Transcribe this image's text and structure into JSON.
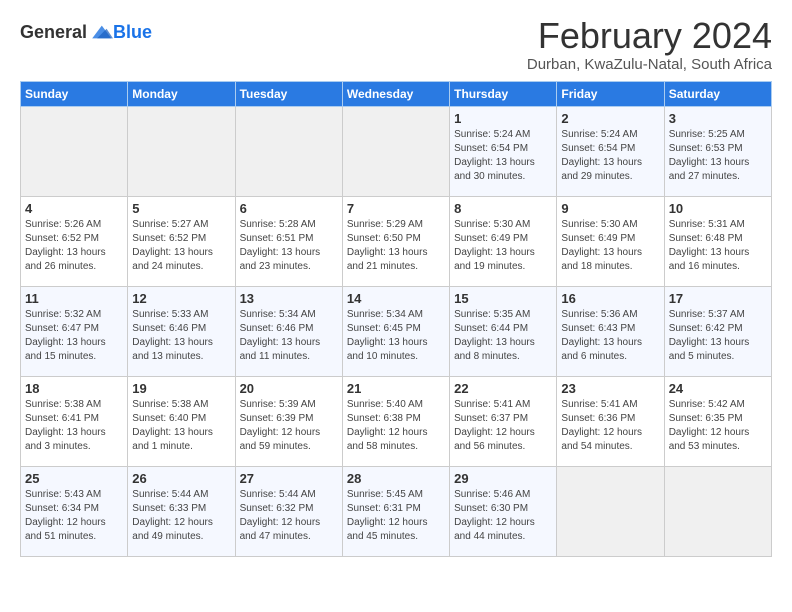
{
  "logo": {
    "general": "General",
    "blue": "Blue"
  },
  "title": "February 2024",
  "location": "Durban, KwaZulu-Natal, South Africa",
  "days_of_week": [
    "Sunday",
    "Monday",
    "Tuesday",
    "Wednesday",
    "Thursday",
    "Friday",
    "Saturday"
  ],
  "weeks": [
    [
      {
        "day": "",
        "info": ""
      },
      {
        "day": "",
        "info": ""
      },
      {
        "day": "",
        "info": ""
      },
      {
        "day": "",
        "info": ""
      },
      {
        "day": "1",
        "info": "Sunrise: 5:24 AM\nSunset: 6:54 PM\nDaylight: 13 hours\nand 30 minutes."
      },
      {
        "day": "2",
        "info": "Sunrise: 5:24 AM\nSunset: 6:54 PM\nDaylight: 13 hours\nand 29 minutes."
      },
      {
        "day": "3",
        "info": "Sunrise: 5:25 AM\nSunset: 6:53 PM\nDaylight: 13 hours\nand 27 minutes."
      }
    ],
    [
      {
        "day": "4",
        "info": "Sunrise: 5:26 AM\nSunset: 6:52 PM\nDaylight: 13 hours\nand 26 minutes."
      },
      {
        "day": "5",
        "info": "Sunrise: 5:27 AM\nSunset: 6:52 PM\nDaylight: 13 hours\nand 24 minutes."
      },
      {
        "day": "6",
        "info": "Sunrise: 5:28 AM\nSunset: 6:51 PM\nDaylight: 13 hours\nand 23 minutes."
      },
      {
        "day": "7",
        "info": "Sunrise: 5:29 AM\nSunset: 6:50 PM\nDaylight: 13 hours\nand 21 minutes."
      },
      {
        "day": "8",
        "info": "Sunrise: 5:30 AM\nSunset: 6:49 PM\nDaylight: 13 hours\nand 19 minutes."
      },
      {
        "day": "9",
        "info": "Sunrise: 5:30 AM\nSunset: 6:49 PM\nDaylight: 13 hours\nand 18 minutes."
      },
      {
        "day": "10",
        "info": "Sunrise: 5:31 AM\nSunset: 6:48 PM\nDaylight: 13 hours\nand 16 minutes."
      }
    ],
    [
      {
        "day": "11",
        "info": "Sunrise: 5:32 AM\nSunset: 6:47 PM\nDaylight: 13 hours\nand 15 minutes."
      },
      {
        "day": "12",
        "info": "Sunrise: 5:33 AM\nSunset: 6:46 PM\nDaylight: 13 hours\nand 13 minutes."
      },
      {
        "day": "13",
        "info": "Sunrise: 5:34 AM\nSunset: 6:46 PM\nDaylight: 13 hours\nand 11 minutes."
      },
      {
        "day": "14",
        "info": "Sunrise: 5:34 AM\nSunset: 6:45 PM\nDaylight: 13 hours\nand 10 minutes."
      },
      {
        "day": "15",
        "info": "Sunrise: 5:35 AM\nSunset: 6:44 PM\nDaylight: 13 hours\nand 8 minutes."
      },
      {
        "day": "16",
        "info": "Sunrise: 5:36 AM\nSunset: 6:43 PM\nDaylight: 13 hours\nand 6 minutes."
      },
      {
        "day": "17",
        "info": "Sunrise: 5:37 AM\nSunset: 6:42 PM\nDaylight: 13 hours\nand 5 minutes."
      }
    ],
    [
      {
        "day": "18",
        "info": "Sunrise: 5:38 AM\nSunset: 6:41 PM\nDaylight: 13 hours\nand 3 minutes."
      },
      {
        "day": "19",
        "info": "Sunrise: 5:38 AM\nSunset: 6:40 PM\nDaylight: 13 hours\nand 1 minute."
      },
      {
        "day": "20",
        "info": "Sunrise: 5:39 AM\nSunset: 6:39 PM\nDaylight: 12 hours\nand 59 minutes."
      },
      {
        "day": "21",
        "info": "Sunrise: 5:40 AM\nSunset: 6:38 PM\nDaylight: 12 hours\nand 58 minutes."
      },
      {
        "day": "22",
        "info": "Sunrise: 5:41 AM\nSunset: 6:37 PM\nDaylight: 12 hours\nand 56 minutes."
      },
      {
        "day": "23",
        "info": "Sunrise: 5:41 AM\nSunset: 6:36 PM\nDaylight: 12 hours\nand 54 minutes."
      },
      {
        "day": "24",
        "info": "Sunrise: 5:42 AM\nSunset: 6:35 PM\nDaylight: 12 hours\nand 53 minutes."
      }
    ],
    [
      {
        "day": "25",
        "info": "Sunrise: 5:43 AM\nSunset: 6:34 PM\nDaylight: 12 hours\nand 51 minutes."
      },
      {
        "day": "26",
        "info": "Sunrise: 5:44 AM\nSunset: 6:33 PM\nDaylight: 12 hours\nand 49 minutes."
      },
      {
        "day": "27",
        "info": "Sunrise: 5:44 AM\nSunset: 6:32 PM\nDaylight: 12 hours\nand 47 minutes."
      },
      {
        "day": "28",
        "info": "Sunrise: 5:45 AM\nSunset: 6:31 PM\nDaylight: 12 hours\nand 45 minutes."
      },
      {
        "day": "29",
        "info": "Sunrise: 5:46 AM\nSunset: 6:30 PM\nDaylight: 12 hours\nand 44 minutes."
      },
      {
        "day": "",
        "info": ""
      },
      {
        "day": "",
        "info": ""
      }
    ]
  ]
}
